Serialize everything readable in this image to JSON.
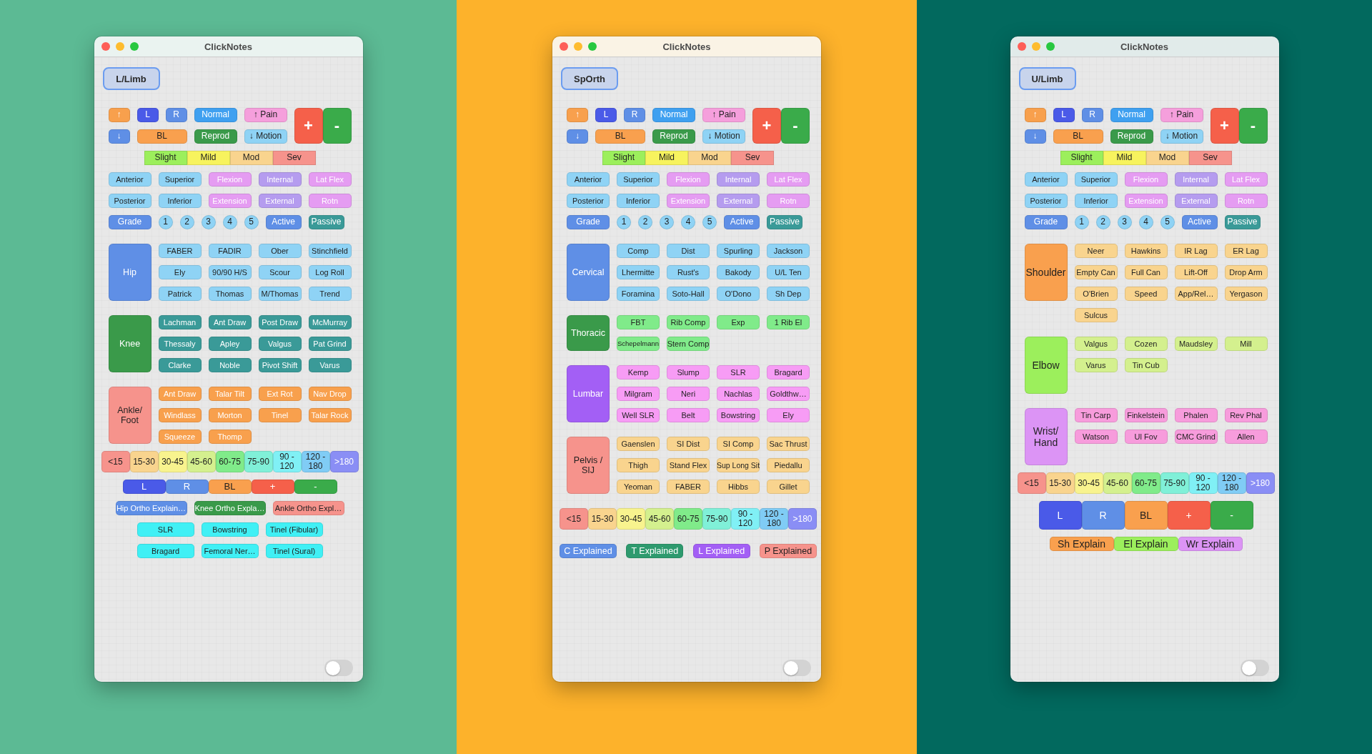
{
  "windows": [
    {
      "kind": "lower",
      "title": "ClickNotes",
      "mode": "L/Limb",
      "top_controls": [
        {
          "label": "↑",
          "color": "#f8a04d"
        },
        {
          "label": "L",
          "color": "#4a5ae8"
        },
        {
          "label": "R",
          "color": "#5f8fe6"
        },
        {
          "label": "Normal",
          "color": "#3fa0f0"
        },
        {
          "label": "↑ Pain",
          "color": "#f59fdc"
        },
        {
          "label": "↓",
          "color": "#5f8fe6"
        },
        {
          "label": "BL",
          "color": "#f9a04e"
        },
        {
          "label": "Reprod",
          "color": "#3a9a4a"
        },
        {
          "label": "↓ Motion",
          "color": "#8fd3f5"
        }
      ],
      "add_remove": [
        {
          "label": "+",
          "color": "#f5604a"
        },
        {
          "label": "-",
          "color": "#3aab4a"
        }
      ],
      "severity": [
        {
          "label": "Slight",
          "color": "#9cef5c"
        },
        {
          "label": "Mild",
          "color": "#f7f35e"
        },
        {
          "label": "Mod",
          "color": "#f9d48e"
        },
        {
          "label": "Sev",
          "color": "#f6938c"
        }
      ],
      "directions": [
        {
          "label": "Anterior",
          "color": "#8fd3f5"
        },
        {
          "label": "Superior",
          "color": "#8fd3f5"
        },
        {
          "label": "Flexion",
          "color": "#e59cf2"
        },
        {
          "label": "Internal",
          "color": "#b59cef"
        },
        {
          "label": "Lat Flex",
          "color": "#e59cf2"
        },
        {
          "label": "Posterior",
          "color": "#8fd3f5"
        },
        {
          "label": "Inferior",
          "color": "#8fd3f5"
        },
        {
          "label": "Extension",
          "color": "#e59cf2"
        },
        {
          "label": "External",
          "color": "#b59cef"
        },
        {
          "label": "Rotn",
          "color": "#e59cf2"
        }
      ],
      "grade": {
        "label": "Grade",
        "color": "#5f8fe6"
      },
      "grade_levels": [
        "1",
        "2",
        "3",
        "4",
        "5"
      ],
      "motion_types": [
        {
          "label": "Active",
          "color": "#5f8fe6"
        },
        {
          "label": "Passive",
          "color": "#3a9a98"
        }
      ],
      "sections": [
        {
          "name": "Hip",
          "color": "#5f8fe6",
          "tests": [
            {
              "label": "FABER",
              "color": "#8fd3f5"
            },
            {
              "label": "FADIR",
              "color": "#8fd3f5"
            },
            {
              "label": "Ober",
              "color": "#8fd3f5"
            },
            {
              "label": "Stinchfield",
              "color": "#8fd3f5"
            },
            {
              "label": "Ely",
              "color": "#8fd3f5"
            },
            {
              "label": "90/90 H/S",
              "color": "#8fd3f5"
            },
            {
              "label": "Scour",
              "color": "#8fd3f5"
            },
            {
              "label": "Log Roll",
              "color": "#8fd3f5"
            },
            {
              "label": "Patrick",
              "color": "#8fd3f5"
            },
            {
              "label": "Thomas",
              "color": "#8fd3f5"
            },
            {
              "label": "M/Thomas",
              "color": "#8fd3f5"
            },
            {
              "label": "Trend",
              "color": "#8fd3f5"
            }
          ]
        },
        {
          "name": "Knee",
          "color": "#3a9a4a",
          "tests": [
            {
              "label": "Lachman",
              "color": "#3a9a98"
            },
            {
              "label": "Ant Draw",
              "color": "#3a9a98"
            },
            {
              "label": "Post Draw",
              "color": "#3a9a98"
            },
            {
              "label": "McMurray",
              "color": "#3a9a98"
            },
            {
              "label": "Thessaly",
              "color": "#3a9a98"
            },
            {
              "label": "Apley",
              "color": "#3a9a98"
            },
            {
              "label": "Valgus",
              "color": "#3a9a98"
            },
            {
              "label": "Pat Grind",
              "color": "#3a9a98"
            },
            {
              "label": "Clarke",
              "color": "#3a9a98"
            },
            {
              "label": "Noble",
              "color": "#3a9a98"
            },
            {
              "label": "Pivot Shift",
              "color": "#3a9a98"
            },
            {
              "label": "Varus",
              "color": "#3a9a98"
            }
          ]
        },
        {
          "name": "Ankle/ Foot",
          "color": "#f6938c",
          "tests": [
            {
              "label": "Ant Draw",
              "color": "#f8a04d"
            },
            {
              "label": "Talar Tilt",
              "color": "#f8a04d"
            },
            {
              "label": "Ext Rot",
              "color": "#f8a04d"
            },
            {
              "label": "Nav Drop",
              "color": "#f8a04d"
            },
            {
              "label": "Windlass",
              "color": "#f8a04d"
            },
            {
              "label": "Morton",
              "color": "#f8a04d"
            },
            {
              "label": "Tinel",
              "color": "#f8a04d"
            },
            {
              "label": "Talar Rock",
              "color": "#f8a04d"
            },
            {
              "label": "Squeeze",
              "color": "#f8a04d"
            },
            {
              "label": "Thomp",
              "color": "#f8a04d"
            }
          ]
        }
      ],
      "ranges": [
        {
          "label": "<15",
          "color": "#f6938c"
        },
        {
          "label": "15-30",
          "color": "#f9d48e"
        },
        {
          "label": "30-45",
          "color": "#f8f38e"
        },
        {
          "label": "45-60",
          "color": "#d4f08e"
        },
        {
          "label": "60-75",
          "color": "#80eb8a"
        },
        {
          "label": "75-90",
          "color": "#80f0d8"
        },
        {
          "label": "90 - 120",
          "color": "#80f0f5"
        },
        {
          "label": "120 - 180",
          "color": "#80ccf5"
        },
        {
          "label": ">180",
          "color": "#8a8ef5"
        }
      ],
      "side_buttons": [
        {
          "label": "L",
          "color": "#4a5ae8"
        },
        {
          "label": "R",
          "color": "#5f8fe6"
        },
        {
          "label": "BL",
          "color": "#f9a04e"
        },
        {
          "label": "+",
          "color": "#f5604a"
        },
        {
          "label": "-",
          "color": "#3aab4a"
        }
      ],
      "explain": [
        {
          "label": "Hip Ortho Explain…",
          "color": "#5f8fe6"
        },
        {
          "label": "Knee Ortho Expla…",
          "color": "#3a9a4a"
        },
        {
          "label": "Ankle Ortho Expl…",
          "color": "#f6938c"
        }
      ],
      "nerve_tests": [
        {
          "label": "SLR",
          "color": "#40f0f5"
        },
        {
          "label": "Bowstring",
          "color": "#40f0f5"
        },
        {
          "label": "Tinel (Fibular)",
          "color": "#40f0f5"
        },
        {
          "label": "Bragard",
          "color": "#40f0f5"
        },
        {
          "label": "Femoral Ner…",
          "color": "#40f0f5"
        },
        {
          "label": "Tinel (Sural)",
          "color": "#40f0f5"
        }
      ],
      "toggle": {
        "on": false
      }
    },
    {
      "kind": "spine",
      "title": "ClickNotes",
      "mode": "SpOrth",
      "top_controls": [
        {
          "label": "↑",
          "color": "#f8a04d"
        },
        {
          "label": "L",
          "color": "#4a5ae8"
        },
        {
          "label": "R",
          "color": "#5f8fe6"
        },
        {
          "label": "Normal",
          "color": "#3fa0f0"
        },
        {
          "label": "↑ Pain",
          "color": "#f59fdc"
        },
        {
          "label": "↓",
          "color": "#5f8fe6"
        },
        {
          "label": "BL",
          "color": "#f9a04e"
        },
        {
          "label": "Reprod",
          "color": "#3a9a4a"
        },
        {
          "label": "↓ Motion",
          "color": "#8fd3f5"
        }
      ],
      "add_remove": [
        {
          "label": "+",
          "color": "#f5604a"
        },
        {
          "label": "-",
          "color": "#3aab4a"
        }
      ],
      "severity": [
        {
          "label": "Slight",
          "color": "#9cef5c"
        },
        {
          "label": "Mild",
          "color": "#f7f35e"
        },
        {
          "label": "Mod",
          "color": "#f9d48e"
        },
        {
          "label": "Sev",
          "color": "#f6938c"
        }
      ],
      "directions": [
        {
          "label": "Anterior",
          "color": "#8fd3f5"
        },
        {
          "label": "Superior",
          "color": "#8fd3f5"
        },
        {
          "label": "Flexion",
          "color": "#e59cf2"
        },
        {
          "label": "Internal",
          "color": "#b59cef"
        },
        {
          "label": "Lat Flex",
          "color": "#e59cf2"
        },
        {
          "label": "Posterior",
          "color": "#8fd3f5"
        },
        {
          "label": "Inferior",
          "color": "#8fd3f5"
        },
        {
          "label": "Extension",
          "color": "#e59cf2"
        },
        {
          "label": "External",
          "color": "#b59cef"
        },
        {
          "label": "Rotn",
          "color": "#e59cf2"
        }
      ],
      "grade": {
        "label": "Grade",
        "color": "#5f8fe6"
      },
      "grade_levels": [
        "1",
        "2",
        "3",
        "4",
        "5"
      ],
      "motion_types": [
        {
          "label": "Active",
          "color": "#5f8fe6"
        },
        {
          "label": "Passive",
          "color": "#3a9a98"
        }
      ],
      "sections": [
        {
          "name": "Cervical",
          "color": "#5f8fe6",
          "tests": [
            {
              "label": "Comp",
              "color": "#8fd3f5"
            },
            {
              "label": "Dist",
              "color": "#8fd3f5"
            },
            {
              "label": "Spurling",
              "color": "#8fd3f5"
            },
            {
              "label": "Jackson",
              "color": "#8fd3f5"
            },
            {
              "label": "Lhermitte",
              "color": "#8fd3f5"
            },
            {
              "label": "Rust's",
              "color": "#8fd3f5"
            },
            {
              "label": "Bakody",
              "color": "#8fd3f5"
            },
            {
              "label": "U/L Ten",
              "color": "#8fd3f5"
            },
            {
              "label": "Foramina",
              "color": "#8fd3f5"
            },
            {
              "label": "Soto-Hall",
              "color": "#8fd3f5"
            },
            {
              "label": "O'Dono",
              "color": "#8fd3f5"
            },
            {
              "label": "Sh Dep",
              "color": "#8fd3f5"
            }
          ]
        },
        {
          "name": "Thoracic",
          "color": "#3a9a4a",
          "tests": [
            {
              "label": "FBT",
              "color": "#80eb8a"
            },
            {
              "label": "Rib Comp",
              "color": "#80eb8a"
            },
            {
              "label": "Exp",
              "color": "#80eb8a"
            },
            {
              "label": "1 Rib El",
              "color": "#80eb8a"
            },
            {
              "label": "Schepelmann",
              "color": "#80eb8a"
            },
            {
              "label": "Stern Comp",
              "color": "#80eb8a"
            }
          ]
        },
        {
          "name": "Lumbar",
          "color": "#a35ff5",
          "tests": [
            {
              "label": "Kemp",
              "color": "#f79cf5"
            },
            {
              "label": "Slump",
              "color": "#f79cf5"
            },
            {
              "label": "SLR",
              "color": "#f79cf5"
            },
            {
              "label": "Bragard",
              "color": "#f79cf5"
            },
            {
              "label": "Milgram",
              "color": "#f79cf5"
            },
            {
              "label": "Neri",
              "color": "#f79cf5"
            },
            {
              "label": "Nachlas",
              "color": "#f79cf5"
            },
            {
              "label": "Goldthw…",
              "color": "#f79cf5"
            },
            {
              "label": "Well SLR",
              "color": "#f79cf5"
            },
            {
              "label": "Belt",
              "color": "#f79cf5"
            },
            {
              "label": "Bowstring",
              "color": "#f79cf5"
            },
            {
              "label": "Ely",
              "color": "#f79cf5"
            }
          ]
        },
        {
          "name": "Pelvis / SIJ",
          "color": "#f6938c",
          "tests": [
            {
              "label": "Gaenslen",
              "color": "#f9d48e"
            },
            {
              "label": "SI Dist",
              "color": "#f9d48e"
            },
            {
              "label": "SI Comp",
              "color": "#f9d48e"
            },
            {
              "label": "Sac Thrust",
              "color": "#f9d48e"
            },
            {
              "label": "Thigh",
              "color": "#f9d48e"
            },
            {
              "label": "Stand Flex",
              "color": "#f9d48e"
            },
            {
              "label": "Sup Long Sit",
              "color": "#f9d48e"
            },
            {
              "label": "Piedallu",
              "color": "#f9d48e"
            },
            {
              "label": "Yeoman",
              "color": "#f9d48e"
            },
            {
              "label": "FABER",
              "color": "#f9d48e"
            },
            {
              "label": "Hibbs",
              "color": "#f9d48e"
            },
            {
              "label": "Gillet",
              "color": "#f9d48e"
            }
          ]
        }
      ],
      "ranges": [
        {
          "label": "<15",
          "color": "#f6938c"
        },
        {
          "label": "15-30",
          "color": "#f9d48e"
        },
        {
          "label": "30-45",
          "color": "#f8f38e"
        },
        {
          "label": "45-60",
          "color": "#d4f08e"
        },
        {
          "label": "60-75",
          "color": "#80eb8a"
        },
        {
          "label": "75-90",
          "color": "#80f0d8"
        },
        {
          "label": "90 - 120",
          "color": "#80f0f5"
        },
        {
          "label": "120 - 180",
          "color": "#80ccf5"
        },
        {
          "label": ">180",
          "color": "#8a8ef5"
        }
      ],
      "explain": [
        {
          "label": "C Explained",
          "color": "#5f8fe6"
        },
        {
          "label": "T Explained",
          "color": "#2e9a6e"
        },
        {
          "label": "L Explained",
          "color": "#a35ff5"
        },
        {
          "label": "P Explained",
          "color": "#f6938c"
        }
      ],
      "toggle": {
        "on": false
      }
    },
    {
      "kind": "upper",
      "title": "ClickNotes",
      "mode": "U/Limb",
      "top_controls": [
        {
          "label": "↑",
          "color": "#f8a04d"
        },
        {
          "label": "L",
          "color": "#4a5ae8"
        },
        {
          "label": "R",
          "color": "#5f8fe6"
        },
        {
          "label": "Normal",
          "color": "#3fa0f0"
        },
        {
          "label": "↑ Pain",
          "color": "#f59fdc"
        },
        {
          "label": "↓",
          "color": "#5f8fe6"
        },
        {
          "label": "BL",
          "color": "#f9a04e"
        },
        {
          "label": "Reprod",
          "color": "#3a9a4a"
        },
        {
          "label": "↓ Motion",
          "color": "#8fd3f5"
        }
      ],
      "add_remove": [
        {
          "label": "+",
          "color": "#f5604a"
        },
        {
          "label": "-",
          "color": "#3aab4a"
        }
      ],
      "severity": [
        {
          "label": "Slight",
          "color": "#9cef5c"
        },
        {
          "label": "Mild",
          "color": "#f7f35e"
        },
        {
          "label": "Mod",
          "color": "#f9d48e"
        },
        {
          "label": "Sev",
          "color": "#f6938c"
        }
      ],
      "directions": [
        {
          "label": "Anterior",
          "color": "#8fd3f5"
        },
        {
          "label": "Superior",
          "color": "#8fd3f5"
        },
        {
          "label": "Flexion",
          "color": "#e59cf2"
        },
        {
          "label": "Internal",
          "color": "#b59cef"
        },
        {
          "label": "Lat Flex",
          "color": "#e59cf2"
        },
        {
          "label": "Posterior",
          "color": "#8fd3f5"
        },
        {
          "label": "Inferior",
          "color": "#8fd3f5"
        },
        {
          "label": "Extension",
          "color": "#e59cf2"
        },
        {
          "label": "External",
          "color": "#b59cef"
        },
        {
          "label": "Rotn",
          "color": "#e59cf2"
        }
      ],
      "grade": {
        "label": "Grade",
        "color": "#5f8fe6"
      },
      "grade_levels": [
        "1",
        "2",
        "3",
        "4",
        "5"
      ],
      "motion_types": [
        {
          "label": "Active",
          "color": "#5f8fe6"
        },
        {
          "label": "Passive",
          "color": "#3a9a98"
        }
      ],
      "sections": [
        {
          "name": "Shoulder",
          "color": "#f9a04e",
          "tests": [
            {
              "label": "Neer",
              "color": "#f9d48e"
            },
            {
              "label": "Hawkins",
              "color": "#f9d48e"
            },
            {
              "label": "IR Lag",
              "color": "#f9d48e"
            },
            {
              "label": "ER Lag",
              "color": "#f9d48e"
            },
            {
              "label": "Empty Can",
              "color": "#f9d48e"
            },
            {
              "label": "Full Can",
              "color": "#f9d48e"
            },
            {
              "label": "Lift-Off",
              "color": "#f9d48e"
            },
            {
              "label": "Drop Arm",
              "color": "#f9d48e"
            },
            {
              "label": "O'Brien",
              "color": "#f9d48e"
            },
            {
              "label": "Speed",
              "color": "#f9d48e"
            },
            {
              "label": "App/Rel…",
              "color": "#f9d48e"
            },
            {
              "label": "Yergason",
              "color": "#f9d48e"
            },
            {
              "label": "Sulcus",
              "color": "#f9d48e"
            }
          ]
        },
        {
          "name": "Elbow",
          "color": "#9cef5c",
          "tests": [
            {
              "label": "Valgus",
              "color": "#d4f08e"
            },
            {
              "label": "Cozen",
              "color": "#d4f08e"
            },
            {
              "label": "Maudsley",
              "color": "#d4f08e"
            },
            {
              "label": "Mill",
              "color": "#d4f08e"
            },
            {
              "label": "Varus",
              "color": "#d4f08e"
            },
            {
              "label": "Tin Cub",
              "color": "#d4f08e"
            }
          ]
        },
        {
          "name": "Wrist/ Hand",
          "color": "#dc94f5",
          "tests": [
            {
              "label": "Tin Carp",
              "color": "#f79cdc"
            },
            {
              "label": "Finkelstein",
              "color": "#f79cdc"
            },
            {
              "label": "Phalen",
              "color": "#f79cdc"
            },
            {
              "label": "Rev Phal",
              "color": "#f79cdc"
            },
            {
              "label": "Watson",
              "color": "#f79cdc"
            },
            {
              "label": "Ul Fov",
              "color": "#f79cdc"
            },
            {
              "label": "CMC Grind",
              "color": "#f79cdc"
            },
            {
              "label": "Allen",
              "color": "#f79cdc"
            }
          ]
        }
      ],
      "ranges": [
        {
          "label": "<15",
          "color": "#f6938c"
        },
        {
          "label": "15-30",
          "color": "#f9d48e"
        },
        {
          "label": "30-45",
          "color": "#f8f38e"
        },
        {
          "label": "45-60",
          "color": "#d4f08e"
        },
        {
          "label": "60-75",
          "color": "#80eb8a"
        },
        {
          "label": "75-90",
          "color": "#80f0d8"
        },
        {
          "label": "90 - 120",
          "color": "#80f0f5"
        },
        {
          "label": "120 - 180",
          "color": "#80ccf5"
        },
        {
          "label": ">180",
          "color": "#8a8ef5"
        }
      ],
      "side_buttons": [
        {
          "label": "L",
          "color": "#4a5ae8"
        },
        {
          "label": "R",
          "color": "#5f8fe6"
        },
        {
          "label": "BL",
          "color": "#f9a04e"
        },
        {
          "label": "+",
          "color": "#f5604a"
        },
        {
          "label": "-",
          "color": "#3aab4a"
        }
      ],
      "explain": [
        {
          "label": "Sh Explain",
          "color": "#f9a04e"
        },
        {
          "label": "El Explain",
          "color": "#9cef5c"
        },
        {
          "label": "Wr Explain",
          "color": "#dc94f5"
        }
      ],
      "toggle": {
        "on": false
      }
    }
  ]
}
